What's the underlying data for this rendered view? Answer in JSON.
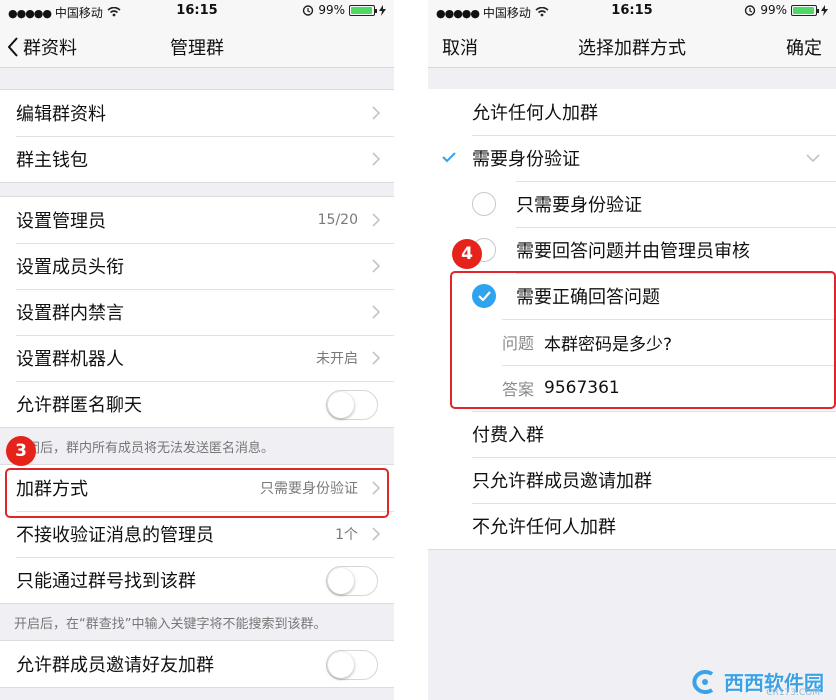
{
  "left": {
    "status": {
      "carrier": "中国移动",
      "time": "16:15",
      "battery": "99%"
    },
    "nav": {
      "back_label": "群资料",
      "title": "管理群"
    },
    "group1": [
      {
        "label": "编辑群资料"
      },
      {
        "label": "群主钱包"
      }
    ],
    "group2": [
      {
        "label": "设置管理员",
        "value": "15/20"
      },
      {
        "label": "设置成员头衔",
        "value": ""
      },
      {
        "label": "设置群内禁言",
        "value": ""
      },
      {
        "label": "设置群机器人",
        "value": "未开启"
      },
      {
        "label": "允许群匿名聊天",
        "toggle": false
      }
    ],
    "anon_note": "关闭后，群内所有成员将无法发送匿名消息。",
    "group3": [
      {
        "label": "加群方式",
        "value": "只需要身份验证"
      },
      {
        "label": "不接收验证消息的管理员",
        "value": "1个"
      },
      {
        "label": "只能通过群号找到该群",
        "toggle": false
      }
    ],
    "search_note": "开启后，在“群查找”中输入关键字将不能搜索到该群。",
    "group4": [
      {
        "label": "允许群成员邀请好友加群",
        "toggle": false
      }
    ],
    "step_badge": "3"
  },
  "right": {
    "status": {
      "carrier": "中国移动",
      "time": "16:15",
      "battery": "99%"
    },
    "nav": {
      "cancel": "取消",
      "title": "选择加群方式",
      "confirm": "确定"
    },
    "options": {
      "anyone": "允许任何人加群",
      "verify": "需要身份验证",
      "verify_only": "只需要身份验证",
      "answer_admin": "需要回答问题并由管理员审核",
      "answer_correct": "需要正确回答问题",
      "question_label": "问题",
      "question_value": "本群密码是多少?",
      "answer_label": "答案",
      "answer_value": "9567361",
      "paid": "付费入群",
      "invite_only": "只允许群成员邀请加群",
      "nobody": "不允许任何人加群"
    },
    "step_badge": "4"
  },
  "watermark": {
    "text": "西西软件园",
    "sub": "CR173.COM"
  },
  "colors": {
    "accent": "#2fa3f0",
    "highlight": "#e0262b",
    "badge": "#e5231b"
  }
}
